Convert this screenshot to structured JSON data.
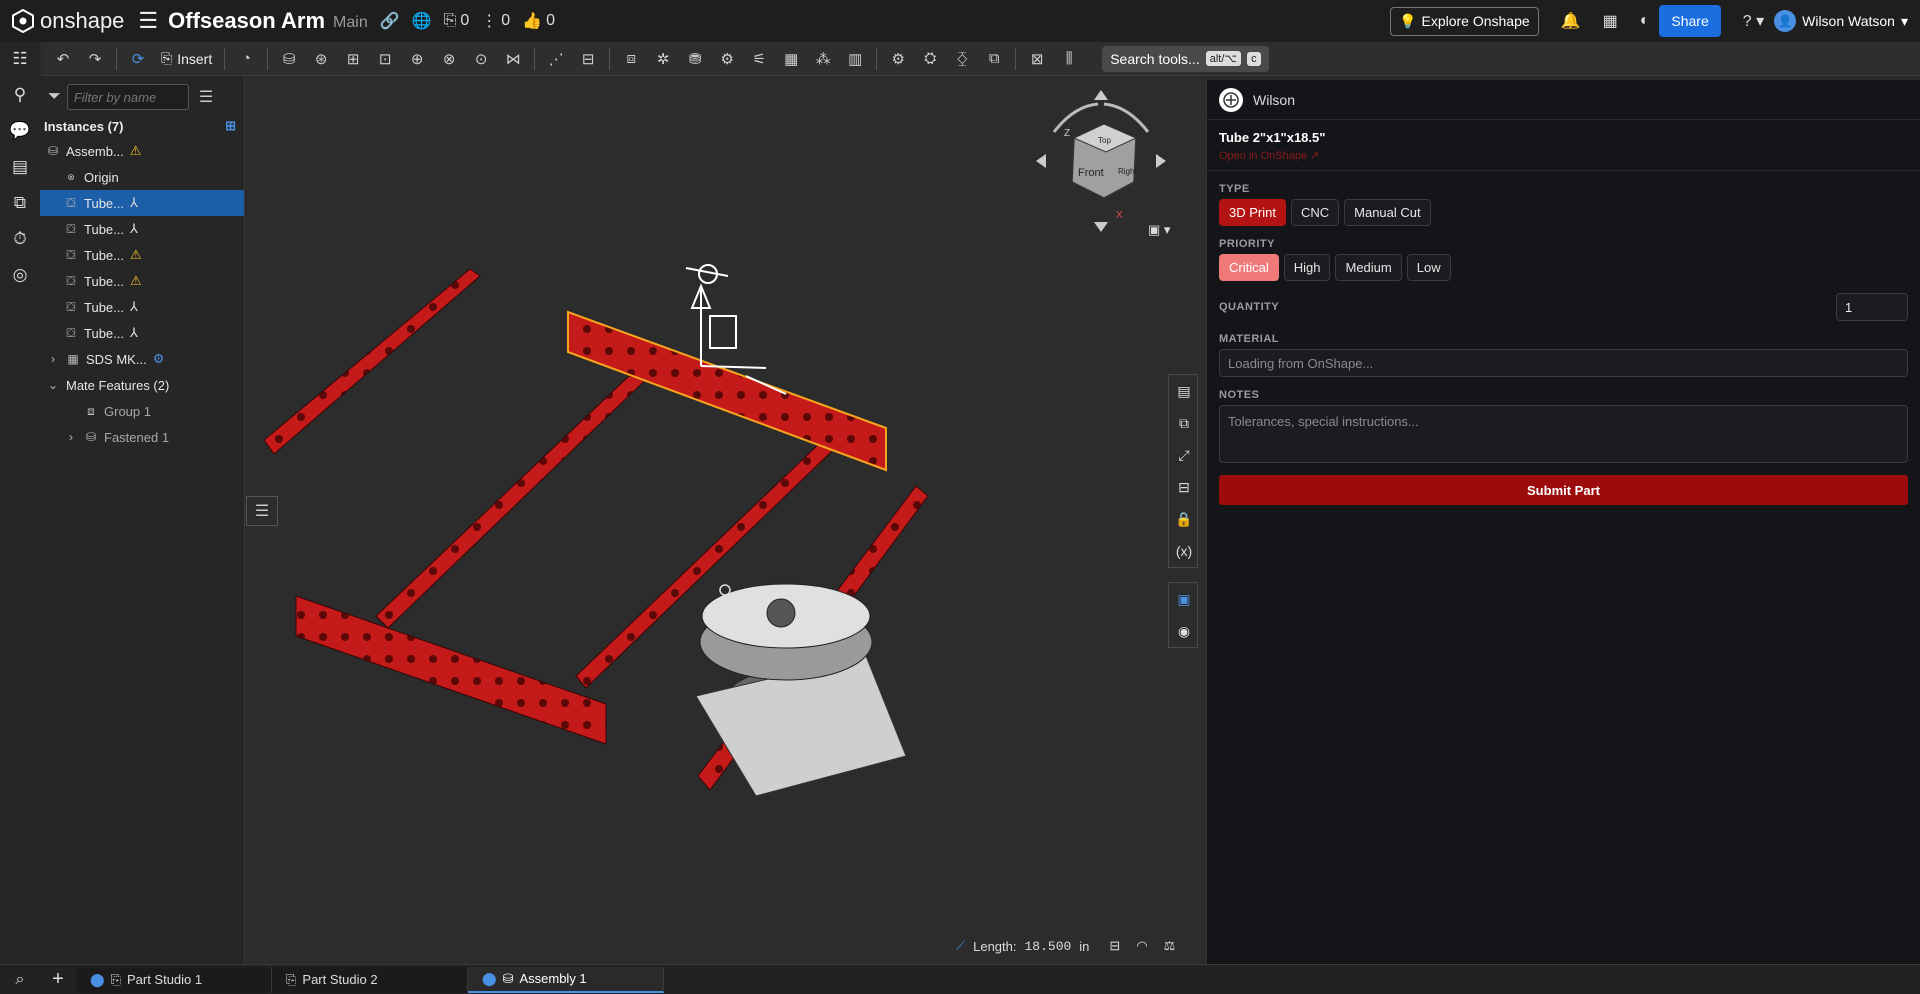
{
  "topbar": {
    "logo": "onshape",
    "doc_title": "Offseason Arm",
    "branch": "Main",
    "counts": {
      "releases": "0",
      "versions": "0",
      "likes": "0"
    },
    "explore": "Explore Onshape",
    "share": "Share",
    "user": "Wilson Watson"
  },
  "toolbar": {
    "insert": "Insert",
    "search": "Search tools...",
    "search_kbd_1": "alt/⌥",
    "search_kbd_2": "c"
  },
  "instances": {
    "filter_placeholder": "Filter by name",
    "header": "Instances (7)",
    "items": [
      {
        "label": "Assemb...",
        "warn": true
      },
      {
        "label": "Origin"
      },
      {
        "label": "Tube..."
      },
      {
        "label": "Tube..."
      },
      {
        "label": "Tube..."
      },
      {
        "label": "Tube..."
      },
      {
        "label": "Tube..."
      },
      {
        "label": "Tube..."
      },
      {
        "label": "SDS MK..."
      },
      {
        "label": "Mate Features (2)"
      },
      {
        "label": "Group 1"
      },
      {
        "label": "Fastened 1"
      }
    ]
  },
  "viewport": {
    "length_label": "Length:",
    "length_value": "18.500",
    "length_unit": "in",
    "cube_labels": {
      "front": "Front",
      "top": "Top",
      "right": "Right",
      "z": "Z",
      "x": "X"
    }
  },
  "panel": {
    "user": "Wilson",
    "part_name": "Tube 2\"x1\"x18.5\"",
    "open_link": "Open in OnShape ↗",
    "type_label": "TYPE",
    "types": [
      "3D Print",
      "CNC",
      "Manual Cut"
    ],
    "priority_label": "PRIORITY",
    "priorities": [
      "Critical",
      "High",
      "Medium",
      "Low"
    ],
    "quantity_label": "QUANTITY",
    "quantity": "1",
    "material_label": "MATERIAL",
    "material_placeholder": "Loading from OnShape...",
    "notes_label": "NOTES",
    "notes_placeholder": "Tolerances, special instructions...",
    "submit": "Submit Part"
  },
  "tabs": [
    "Part Studio 1",
    "Part Studio 2",
    "Assembly 1"
  ],
  "colors": {
    "accent": "#1a6ee0",
    "tube_red": "#c41a1a",
    "submit": "#9c0c0c",
    "critical": "#f07a7a"
  }
}
